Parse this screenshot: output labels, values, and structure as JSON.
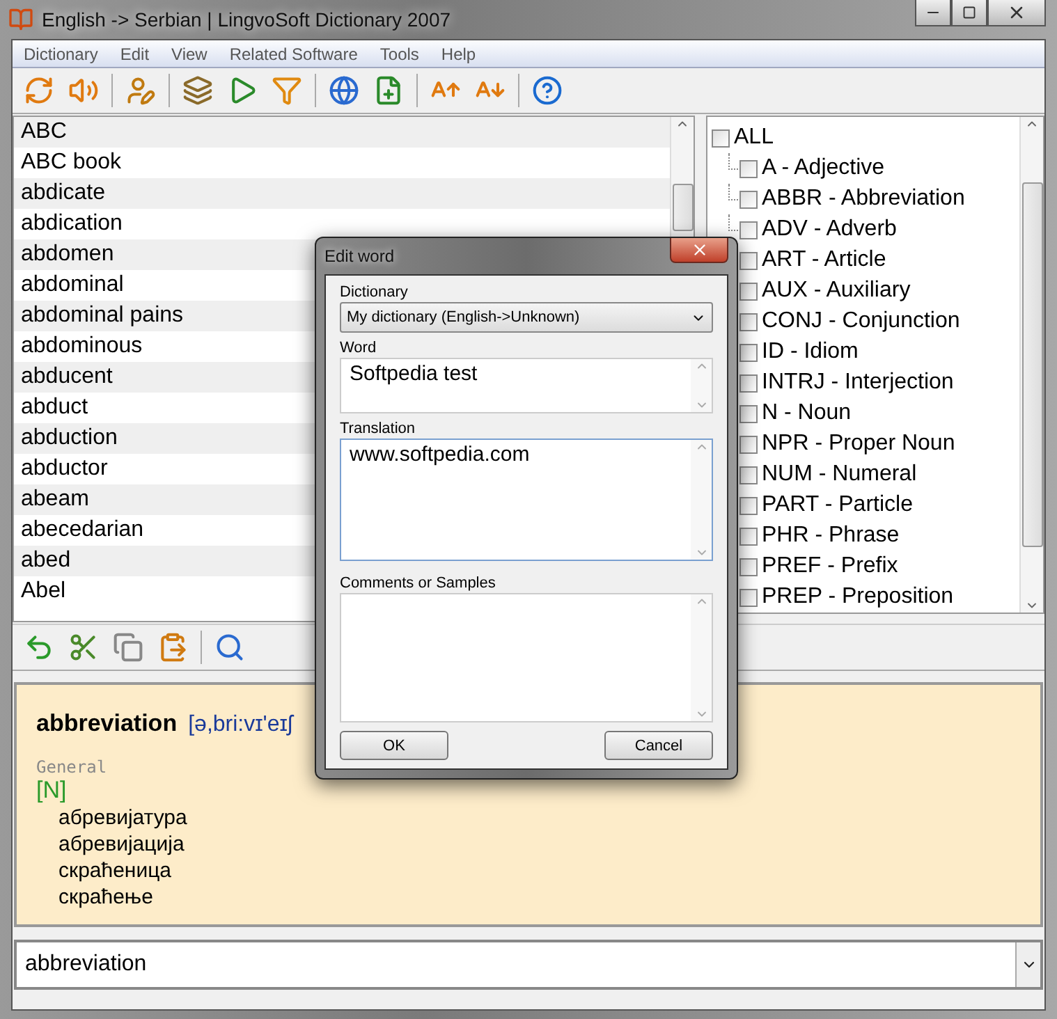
{
  "window": {
    "title": "English -> Serbian | LingvoSoft Dictionary 2007"
  },
  "menu": [
    "Dictionary",
    "Edit",
    "View",
    "Related Software",
    "Tools",
    "Help"
  ],
  "word_list": [
    "ABC",
    "ABC book",
    "abdicate",
    "abdication",
    "abdomen",
    "abdominal",
    "abdominal pains",
    "abdominous",
    "abducent",
    "abduct",
    "abduction",
    "abductor",
    "abeam",
    "abecedarian",
    "abed",
    "Abel"
  ],
  "categories": {
    "label": "ALL",
    "checked": false,
    "children": [
      {
        "label": "A - Adjective",
        "checked": false
      },
      {
        "label": "ABBR - Abbreviation",
        "checked": false
      },
      {
        "label": "ADV - Adverb",
        "checked": false
      },
      {
        "label": "ART - Article",
        "checked": false
      },
      {
        "label": "AUX - Auxiliary",
        "checked": false
      },
      {
        "label": "CONJ - Conjunction",
        "checked": false
      },
      {
        "label": "ID - Idiom",
        "checked": false
      },
      {
        "label": "INTRJ - Interjection",
        "checked": false
      },
      {
        "label": "N - Noun",
        "checked": false
      },
      {
        "label": "NPR - Proper Noun",
        "checked": false
      },
      {
        "label": "NUM - Numeral",
        "checked": false
      },
      {
        "label": "PART - Particle",
        "checked": false
      },
      {
        "label": "PHR - Phrase",
        "checked": false
      },
      {
        "label": "PREF - Prefix",
        "checked": false
      },
      {
        "label": "PREP - Preposition",
        "checked": false
      }
    ]
  },
  "entry": {
    "headword": "abbreviation",
    "pronunciation": "[ə,bri:vɪ'eɪʃ",
    "domain": "General",
    "part_of_speech": "[N]",
    "translations": [
      "абревијатура",
      "абревијација",
      "скраћеница",
      "скраћење"
    ]
  },
  "search": {
    "value": "abbreviation"
  },
  "dialog": {
    "title": "Edit word",
    "dictionary_label": "Dictionary",
    "dictionary_value": "My dictionary (English->Unknown)",
    "word_label": "Word",
    "word_value": "Softpedia test",
    "translation_label": "Translation",
    "translation_value": "www.softpedia.com",
    "comments_label": "Comments or Samples",
    "buttons": [
      "OK",
      "Cancel"
    ]
  }
}
